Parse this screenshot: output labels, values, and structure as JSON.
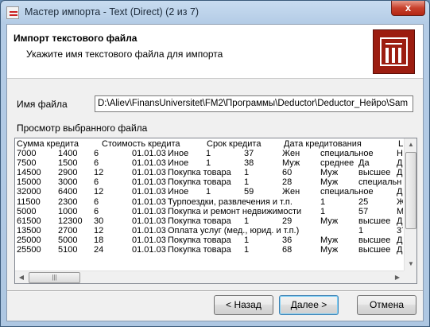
{
  "window": {
    "title": "Мастер импорта - Text (Direct) (2 из 7)",
    "close_label": "x"
  },
  "header": {
    "title": "Импорт текстового файла",
    "subtitle": "Укажите имя текстового файла для импорта",
    "logo_icon": "import-table-icon"
  },
  "file": {
    "label": "Имя файла",
    "value": "D:\\Aliev\\FinansUniversitet\\FM2\\Программы\\Deductor\\Deductor_Нейро\\Sam",
    "browse_label": "..."
  },
  "preview": {
    "label": "Просмотр выбранного файла",
    "columns": [
      "Сумма кредита",
      "Стоимость кредита",
      "Срок кредита",
      "Дата кредитования",
      "Ц"
    ],
    "rows": [
      [
        "7000",
        "1400",
        "6",
        "01.01.03",
        "Иное",
        "1",
        "37",
        "Жен",
        "специальное",
        "Н"
      ],
      [
        "7500",
        "1500",
        "6",
        "01.01.03",
        "Иное",
        "1",
        "38",
        "Муж",
        "среднее",
        "Да",
        "Д"
      ],
      [
        "14500",
        "2900",
        "12",
        "01.01.03",
        "Покупка товара",
        "1",
        "60",
        "Муж",
        "высшее",
        "Д"
      ],
      [
        "15000",
        "3000",
        "6",
        "01.01.03",
        "Покупка товара",
        "1",
        "28",
        "Муж",
        "специальн"
      ],
      [
        "32000",
        "6400",
        "12",
        "01.01.03",
        "Иное",
        "1",
        "59",
        "Жен",
        "специальное",
        "Д"
      ],
      [
        "11500",
        "2300",
        "6",
        "01.01.03",
        "Турпоездки, развлечения и т.п.",
        "1",
        "25",
        "Ж"
      ],
      [
        "5000",
        "1000",
        "6",
        "01.01.03",
        "Покупка и ремонт недвижимости",
        "1",
        "57",
        "М"
      ],
      [
        "61500",
        "12300",
        "30",
        "01.01.03",
        "Покупка товара",
        "1",
        "29",
        "Муж",
        "высшее",
        "Д"
      ],
      [
        "13500",
        "2700",
        "12",
        "01.01.03",
        "Оплата услуг (мед., юрид. и т.п.)",
        "1",
        "37",
        "М"
      ],
      [
        "25000",
        "5000",
        "18",
        "01.01.03",
        "Покупка товара",
        "1",
        "36",
        "Муж",
        "высшее",
        "Д"
      ],
      [
        "25500",
        "5100",
        "24",
        "01.01.03",
        "Покупка товара",
        "1",
        "68",
        "Муж",
        "высшее",
        "Д"
      ]
    ]
  },
  "buttons": {
    "back": "< Назад",
    "next": "Далее >",
    "cancel": "Отмена"
  },
  "colors": {
    "logo": "#9c1d10",
    "close": "#c8412d"
  }
}
